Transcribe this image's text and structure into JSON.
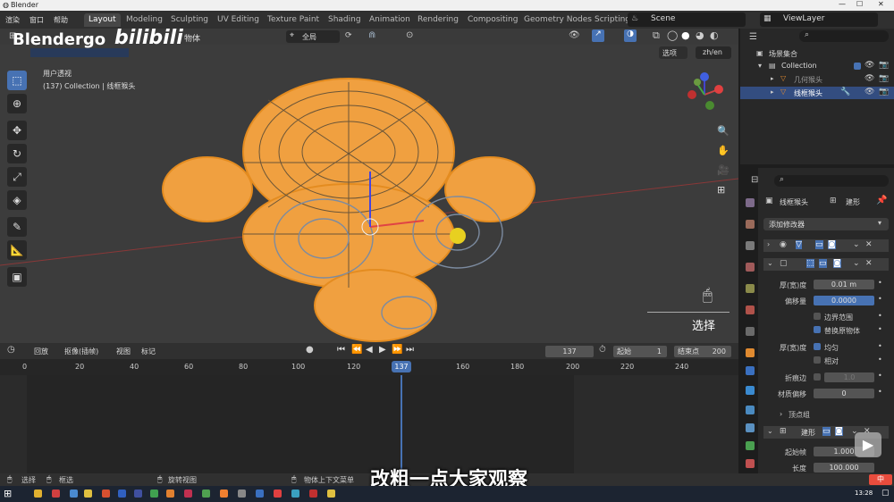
{
  "window": {
    "title": "Blender"
  },
  "menubar": {
    "items": [
      "渲染",
      "窗口",
      "帮助"
    ],
    "tabs": [
      "Layout",
      "Modeling",
      "Sculpting",
      "UV Editing",
      "Texture Paint",
      "Shading",
      "Animation",
      "Rendering",
      "Compositing",
      "Geometry Nodes",
      "Scripting"
    ],
    "scene": "Scene",
    "view_layer": "ViewLayer"
  },
  "watermark": {
    "channel": "Blendergo",
    "site": "bilibili"
  },
  "viewport": {
    "object_menu": "物体",
    "transform": "全局",
    "options": "选项",
    "lang": "zh/en",
    "view_name": "用户透视",
    "collection_info": "(137) Collection | 线框猴头",
    "hint": "选择"
  },
  "outliner": {
    "title": "场景集合",
    "collection": "Collection",
    "items": [
      {
        "label": "几何猴头"
      },
      {
        "label": "线框猴头"
      }
    ]
  },
  "properties": {
    "object": "线框猴头",
    "modifier_ctx": "建形",
    "add_modifier": "添加修改器",
    "thickness_label": "厚(宽)度",
    "thickness": "0.01 m",
    "offset_label": "偏移量",
    "offset": "0.0000",
    "boundary": "边界范围",
    "replace": "替换原物体",
    "thickness2": "厚(宽)度",
    "even": "均匀",
    "relative": "相对",
    "crease_label": "折痕边",
    "crease": "1.0",
    "mat_label": "材质偏移",
    "mat": "0",
    "vgroup": "顶点组",
    "mod2": "建形",
    "start_label": "起始帧",
    "start": "1.000",
    "len_label": "长度",
    "len": "100.000"
  },
  "timeline": {
    "playback": "回放",
    "keying": "抠像(插帧)",
    "view": "视图",
    "marker": "标记",
    "current": "137",
    "start_label": "起始",
    "start": "1",
    "end_label": "结束点",
    "end": "200",
    "ticks": [
      "0",
      "20",
      "40",
      "60",
      "80",
      "100",
      "120",
      "137",
      "160",
      "180",
      "200",
      "220",
      "240"
    ]
  },
  "statusbar": {
    "select": "选择",
    "box": "框选",
    "rotate": "旋转视图",
    "ctx": "物体上下文菜单"
  },
  "subtitle": "改粗一点大家观察",
  "taskbar": {
    "time": "13:28",
    "ime": "中"
  }
}
